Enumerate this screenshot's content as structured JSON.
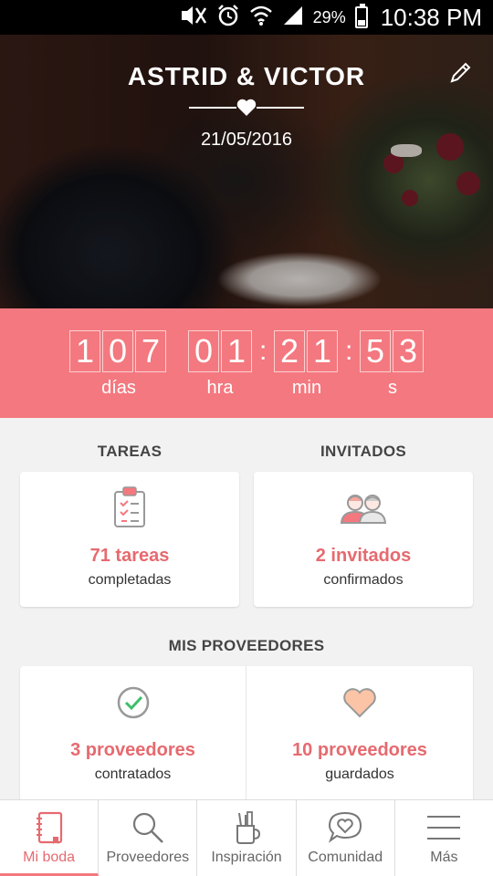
{
  "status_bar": {
    "battery": "29%",
    "time": "10:38 PM",
    "icons": [
      "mute-icon",
      "alarm-icon",
      "wifi-icon",
      "signal-icon",
      "battery-icon"
    ]
  },
  "hero": {
    "names": "ASTRID & VICTOR",
    "date": "21/05/2016",
    "icons": [
      "heart-icon",
      "edit-pencil-icon"
    ]
  },
  "countdown": {
    "days": [
      "1",
      "0",
      "7"
    ],
    "hours": [
      "0",
      "1"
    ],
    "minutes": [
      "2",
      "1"
    ],
    "seconds": [
      "5",
      "3"
    ],
    "separator": ":",
    "labels": {
      "days": "días",
      "hours": "hra",
      "minutes": "min",
      "seconds": "s"
    }
  },
  "tareas": {
    "title": "TAREAS",
    "count": "71 tareas",
    "subtitle": "completadas",
    "icon": "clipboard-icon"
  },
  "invitados": {
    "title": "INVITADOS",
    "count": "2 invitados",
    "subtitle": "confirmados",
    "icon": "guests-icon"
  },
  "proveedores": {
    "title": "MIS PROVEEDORES",
    "hired": {
      "count": "3 proveedores",
      "subtitle": "contratados",
      "icon": "check-circle-icon"
    },
    "saved": {
      "count": "10 proveedores",
      "subtitle": "guardados",
      "icon": "heart-icon"
    }
  },
  "nav": [
    {
      "label": "Mi boda",
      "icon": "notebook-icon",
      "active": true
    },
    {
      "label": "Proveedores",
      "icon": "search-icon",
      "active": false
    },
    {
      "label": "Inspiración",
      "icon": "tools-cup-icon",
      "active": false
    },
    {
      "label": "Comunidad",
      "icon": "chat-heart-icon",
      "active": false
    },
    {
      "label": "Más",
      "icon": "menu-icon",
      "active": false
    }
  ],
  "colors": {
    "accent": "#f4787f",
    "accent_text": "#e66a6f",
    "background": "#f2f2f2"
  }
}
